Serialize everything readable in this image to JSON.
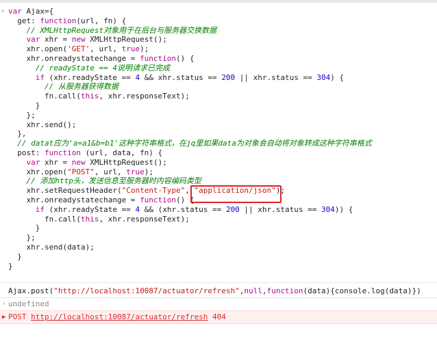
{
  "console": {
    "lines": [
      [
        [
          "var ",
          "k"
        ],
        [
          "Ajax",
          "p"
        ],
        [
          "={",
          "p"
        ]
      ],
      [
        [
          "  get: ",
          "p"
        ],
        [
          "function",
          "k"
        ],
        [
          "(url, fn) {",
          "p"
        ]
      ],
      [
        [
          "    ",
          "p"
        ],
        [
          "// XMLHttpRequest对象用于在后台与服务器交换数据",
          "c"
        ]
      ],
      [
        [
          "    ",
          "p"
        ],
        [
          "var ",
          "k"
        ],
        [
          "xhr = ",
          "p"
        ],
        [
          "new ",
          "k"
        ],
        [
          "XMLHttpRequest();",
          "p"
        ]
      ],
      [
        [
          "    xhr.open(",
          "p"
        ],
        [
          "'GET'",
          "s"
        ],
        [
          ", url, ",
          "p"
        ],
        [
          "true",
          "k"
        ],
        [
          ");",
          "p"
        ]
      ],
      [
        [
          "    xhr.onreadystatechange = ",
          "p"
        ],
        [
          "function",
          "k"
        ],
        [
          "() {",
          "p"
        ]
      ],
      [
        [
          "      ",
          "p"
        ],
        [
          "// readyState == 4说明请求已完成",
          "c"
        ]
      ],
      [
        [
          "      ",
          "p"
        ],
        [
          "if ",
          "k"
        ],
        [
          "(xhr.readyState == ",
          "p"
        ],
        [
          "4",
          "n"
        ],
        [
          " && xhr.status == ",
          "p"
        ],
        [
          "200",
          "n"
        ],
        [
          " || xhr.status == ",
          "p"
        ],
        [
          "304",
          "n"
        ],
        [
          ") {",
          "p"
        ]
      ],
      [
        [
          "        ",
          "p"
        ],
        [
          "// 从服务器获得数据",
          "c"
        ]
      ],
      [
        [
          "        fn.call(",
          "p"
        ],
        [
          "this",
          "k"
        ],
        [
          ", xhr.responseText);",
          "p"
        ]
      ],
      [
        [
          "      }",
          "p"
        ]
      ],
      [
        [
          "    };",
          "p"
        ]
      ],
      [
        [
          "    xhr.send();",
          "p"
        ]
      ],
      [
        [
          "  },",
          "p"
        ]
      ],
      [
        [
          "  ",
          "p"
        ],
        [
          "// datat应为'a=a1&b=b1'这种字符串格式，在jq里如果data为对象会自动将对象转成这种字符串格式",
          "c"
        ]
      ],
      [
        [
          "  post: ",
          "p"
        ],
        [
          "function ",
          "k"
        ],
        [
          "(url, data, fn) {",
          "p"
        ]
      ],
      [
        [
          "    ",
          "p"
        ],
        [
          "var ",
          "k"
        ],
        [
          "xhr = ",
          "p"
        ],
        [
          "new ",
          "k"
        ],
        [
          "XMLHttpRequest();",
          "p"
        ]
      ],
      [
        [
          "    xhr.open(",
          "p"
        ],
        [
          "\"POST\"",
          "s"
        ],
        [
          ", url, ",
          "p"
        ],
        [
          "true",
          "k"
        ],
        [
          ");",
          "p"
        ]
      ],
      [
        [
          "    ",
          "p"
        ],
        [
          "// 添加http头，发送信息至服务器时内容编码类型",
          "c"
        ]
      ],
      [
        [
          "    xhr.setRequestHeader(",
          "p"
        ],
        [
          "\"Content-Type\"",
          "s"
        ],
        [
          ", ",
          "p"
        ],
        [
          "\"application/json\"",
          "s"
        ],
        [
          ");",
          "p"
        ]
      ],
      [
        [
          "    xhr.onreadystatechange = ",
          "p"
        ],
        [
          "function",
          "k"
        ],
        [
          "() {",
          "p"
        ]
      ],
      [
        [
          "      ",
          "p"
        ],
        [
          "if ",
          "k"
        ],
        [
          "(xhr.readyState == ",
          "p"
        ],
        [
          "4",
          "n"
        ],
        [
          " && (xhr.status == ",
          "p"
        ],
        [
          "200",
          "n"
        ],
        [
          " || xhr.status == ",
          "p"
        ],
        [
          "304",
          "n"
        ],
        [
          ")) {",
          "p"
        ]
      ],
      [
        [
          "        fn.call(",
          "p"
        ],
        [
          "this",
          "k"
        ],
        [
          ", xhr.responseText);",
          "p"
        ]
      ],
      [
        [
          "      }",
          "p"
        ]
      ],
      [
        [
          "    };",
          "p"
        ]
      ],
      [
        [
          "    xhr.send(data);",
          "p"
        ]
      ],
      [
        [
          "  }",
          "p"
        ]
      ],
      [
        [
          "}",
          "p"
        ]
      ]
    ],
    "command": [
      [
        "Ajax.post(",
        "p"
      ],
      [
        "\"http://localhost:10087/actuator/refresh\"",
        "s"
      ],
      [
        ",",
        "p"
      ],
      [
        "null",
        "k"
      ],
      [
        ",",
        "p"
      ],
      [
        "function",
        "k"
      ],
      [
        "(data){console.log(data)})",
        "p"
      ]
    ],
    "result": "undefined",
    "error": {
      "method": "POST",
      "url": "http://localhost:10087/actuator/refresh",
      "status": "404"
    }
  },
  "colors": {
    "keyword": "#aa0d91",
    "string": "#c41a16",
    "comment": "#008000",
    "number": "#1c00cf",
    "error": "#e0292f",
    "highlight_box": "#e02020"
  }
}
